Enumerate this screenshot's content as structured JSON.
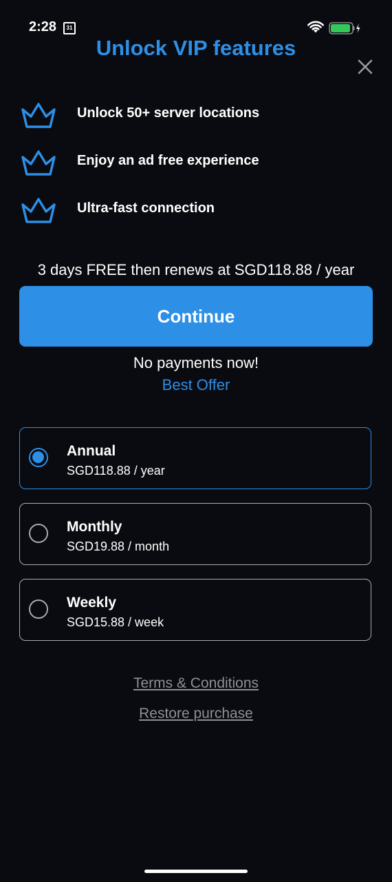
{
  "status_bar": {
    "time": "2:28",
    "calendar_day": "31",
    "icons": [
      "calendar-icon",
      "wifi-icon",
      "battery-charging-icon"
    ]
  },
  "header": {
    "title": "Unlock VIP features",
    "close_icon": "close-icon"
  },
  "features": [
    {
      "icon": "crown-icon",
      "text": "Unlock 50+ server locations"
    },
    {
      "icon": "crown-icon",
      "text": "Enjoy an ad free experience"
    },
    {
      "icon": "crown-icon",
      "text": "Ultra-fast connection"
    }
  ],
  "offer": {
    "trial_text": "3 days FREE then renews at SGD118.88 / year",
    "continue_label": "Continue",
    "no_payments": "No payments now!",
    "best_offer": "Best Offer"
  },
  "plans": [
    {
      "name": "Annual",
      "price": "SGD118.88 / year",
      "selected": true
    },
    {
      "name": "Monthly",
      "price": "SGD19.88 / month",
      "selected": false
    },
    {
      "name": "Weekly",
      "price": "SGD15.88 / week",
      "selected": false
    }
  ],
  "links": {
    "terms": "Terms & Conditions",
    "restore": "Restore purchase"
  },
  "colors": {
    "accent": "#2d8fe6",
    "background": "#0a0b10",
    "muted": "#8e9097",
    "battery_fill": "#34c759"
  }
}
